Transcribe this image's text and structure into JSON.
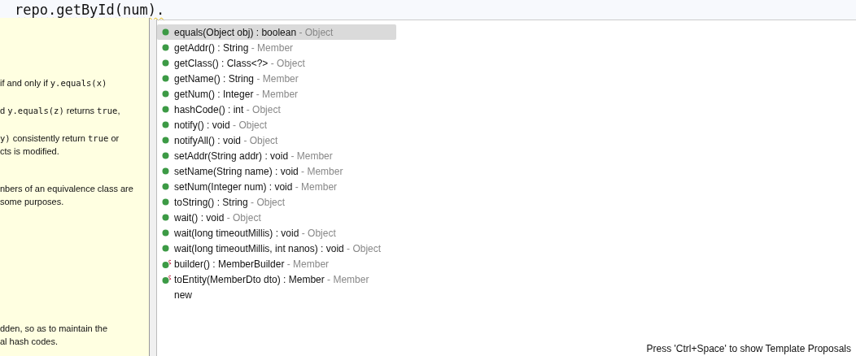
{
  "editor": {
    "code_line": "repo.getById(num)."
  },
  "javadoc": {
    "lines": [
      {
        "segments": [
          {
            "kind": "text",
            "text": "if and only if "
          },
          {
            "kind": "code",
            "text": "y.equals(x)"
          }
        ]
      },
      {
        "segments": [
          {
            "kind": "text",
            "text": "d "
          },
          {
            "kind": "code",
            "text": "y.equals(z)"
          },
          {
            "kind": "text",
            "text": " returns "
          },
          {
            "kind": "code",
            "text": "true"
          },
          {
            "kind": "text",
            "text": ","
          }
        ]
      },
      {
        "segments": [
          {
            "kind": "code",
            "text": "y)"
          },
          {
            "kind": "text",
            "text": " consistently return "
          },
          {
            "kind": "code",
            "text": "true"
          },
          {
            "kind": "text",
            "text": " or"
          }
        ]
      },
      {
        "segments": [
          {
            "kind": "text",
            "text": "cts is modified."
          }
        ]
      },
      {
        "segments": [
          {
            "kind": "text",
            "text": "nbers of an equivalence class are"
          }
        ]
      },
      {
        "segments": [
          {
            "kind": "text",
            "text": " some purposes."
          }
        ]
      },
      {
        "segments": [
          {
            "kind": "text",
            "text": "dden, so as to maintain the"
          }
        ]
      },
      {
        "segments": [
          {
            "kind": "text",
            "text": "al hash codes."
          }
        ]
      }
    ]
  },
  "proposals": {
    "items": [
      {
        "kind": "method",
        "signature": "equals(Object obj) : boolean",
        "owner": "- Object",
        "selected": true
      },
      {
        "kind": "method",
        "signature": "getAddr() : String",
        "owner": "- Member",
        "selected": false
      },
      {
        "kind": "method",
        "signature": "getClass() : Class<?>",
        "owner": "- Object",
        "selected": false
      },
      {
        "kind": "method",
        "signature": "getName() : String",
        "owner": "- Member",
        "selected": false
      },
      {
        "kind": "method",
        "signature": "getNum() : Integer",
        "owner": "- Member",
        "selected": false
      },
      {
        "kind": "method",
        "signature": "hashCode() : int",
        "owner": "- Object",
        "selected": false
      },
      {
        "kind": "method",
        "signature": "notify() : void",
        "owner": "- Object",
        "selected": false
      },
      {
        "kind": "method",
        "signature": "notifyAll() : void",
        "owner": "- Object",
        "selected": false
      },
      {
        "kind": "method",
        "signature": "setAddr(String addr) : void",
        "owner": "- Member",
        "selected": false
      },
      {
        "kind": "method",
        "signature": "setName(String name) : void",
        "owner": "- Member",
        "selected": false
      },
      {
        "kind": "method",
        "signature": "setNum(Integer num) : void",
        "owner": "- Member",
        "selected": false
      },
      {
        "kind": "method",
        "signature": "toString() : String",
        "owner": "- Object",
        "selected": false
      },
      {
        "kind": "method",
        "signature": "wait() : void",
        "owner": "- Object",
        "selected": false
      },
      {
        "kind": "method",
        "signature": "wait(long timeoutMillis) : void",
        "owner": "- Object",
        "selected": false
      },
      {
        "kind": "method",
        "signature": "wait(long timeoutMillis, int nanos) : void",
        "owner": "- Object",
        "selected": false
      },
      {
        "kind": "static",
        "signature": "builder() : MemberBuilder",
        "owner": "- Member",
        "selected": false
      },
      {
        "kind": "static",
        "signature": "toEntity(MemberDto dto) : Member",
        "owner": "- Member",
        "selected": false
      },
      {
        "kind": "keyword",
        "signature": "new",
        "selected": false
      }
    ],
    "status": "Press 'Ctrl+Space' to show Template Proposals"
  }
}
